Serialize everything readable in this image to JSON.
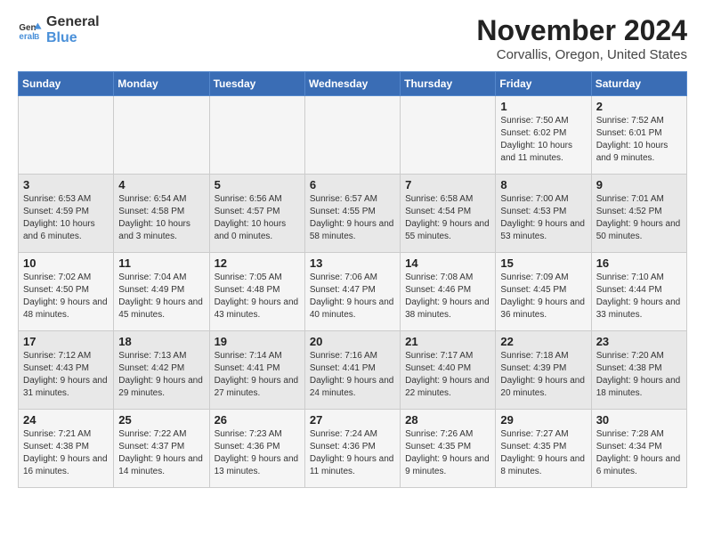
{
  "header": {
    "logo_line1": "General",
    "logo_line2": "Blue",
    "month_title": "November 2024",
    "location": "Corvallis, Oregon, United States"
  },
  "weekdays": [
    "Sunday",
    "Monday",
    "Tuesday",
    "Wednesday",
    "Thursday",
    "Friday",
    "Saturday"
  ],
  "weeks": [
    [
      {
        "day": "",
        "info": ""
      },
      {
        "day": "",
        "info": ""
      },
      {
        "day": "",
        "info": ""
      },
      {
        "day": "",
        "info": ""
      },
      {
        "day": "",
        "info": ""
      },
      {
        "day": "1",
        "info": "Sunrise: 7:50 AM\nSunset: 6:02 PM\nDaylight: 10 hours and 11 minutes."
      },
      {
        "day": "2",
        "info": "Sunrise: 7:52 AM\nSunset: 6:01 PM\nDaylight: 10 hours and 9 minutes."
      }
    ],
    [
      {
        "day": "3",
        "info": "Sunrise: 6:53 AM\nSunset: 4:59 PM\nDaylight: 10 hours and 6 minutes."
      },
      {
        "day": "4",
        "info": "Sunrise: 6:54 AM\nSunset: 4:58 PM\nDaylight: 10 hours and 3 minutes."
      },
      {
        "day": "5",
        "info": "Sunrise: 6:56 AM\nSunset: 4:57 PM\nDaylight: 10 hours and 0 minutes."
      },
      {
        "day": "6",
        "info": "Sunrise: 6:57 AM\nSunset: 4:55 PM\nDaylight: 9 hours and 58 minutes."
      },
      {
        "day": "7",
        "info": "Sunrise: 6:58 AM\nSunset: 4:54 PM\nDaylight: 9 hours and 55 minutes."
      },
      {
        "day": "8",
        "info": "Sunrise: 7:00 AM\nSunset: 4:53 PM\nDaylight: 9 hours and 53 minutes."
      },
      {
        "day": "9",
        "info": "Sunrise: 7:01 AM\nSunset: 4:52 PM\nDaylight: 9 hours and 50 minutes."
      }
    ],
    [
      {
        "day": "10",
        "info": "Sunrise: 7:02 AM\nSunset: 4:50 PM\nDaylight: 9 hours and 48 minutes."
      },
      {
        "day": "11",
        "info": "Sunrise: 7:04 AM\nSunset: 4:49 PM\nDaylight: 9 hours and 45 minutes."
      },
      {
        "day": "12",
        "info": "Sunrise: 7:05 AM\nSunset: 4:48 PM\nDaylight: 9 hours and 43 minutes."
      },
      {
        "day": "13",
        "info": "Sunrise: 7:06 AM\nSunset: 4:47 PM\nDaylight: 9 hours and 40 minutes."
      },
      {
        "day": "14",
        "info": "Sunrise: 7:08 AM\nSunset: 4:46 PM\nDaylight: 9 hours and 38 minutes."
      },
      {
        "day": "15",
        "info": "Sunrise: 7:09 AM\nSunset: 4:45 PM\nDaylight: 9 hours and 36 minutes."
      },
      {
        "day": "16",
        "info": "Sunrise: 7:10 AM\nSunset: 4:44 PM\nDaylight: 9 hours and 33 minutes."
      }
    ],
    [
      {
        "day": "17",
        "info": "Sunrise: 7:12 AM\nSunset: 4:43 PM\nDaylight: 9 hours and 31 minutes."
      },
      {
        "day": "18",
        "info": "Sunrise: 7:13 AM\nSunset: 4:42 PM\nDaylight: 9 hours and 29 minutes."
      },
      {
        "day": "19",
        "info": "Sunrise: 7:14 AM\nSunset: 4:41 PM\nDaylight: 9 hours and 27 minutes."
      },
      {
        "day": "20",
        "info": "Sunrise: 7:16 AM\nSunset: 4:41 PM\nDaylight: 9 hours and 24 minutes."
      },
      {
        "day": "21",
        "info": "Sunrise: 7:17 AM\nSunset: 4:40 PM\nDaylight: 9 hours and 22 minutes."
      },
      {
        "day": "22",
        "info": "Sunrise: 7:18 AM\nSunset: 4:39 PM\nDaylight: 9 hours and 20 minutes."
      },
      {
        "day": "23",
        "info": "Sunrise: 7:20 AM\nSunset: 4:38 PM\nDaylight: 9 hours and 18 minutes."
      }
    ],
    [
      {
        "day": "24",
        "info": "Sunrise: 7:21 AM\nSunset: 4:38 PM\nDaylight: 9 hours and 16 minutes."
      },
      {
        "day": "25",
        "info": "Sunrise: 7:22 AM\nSunset: 4:37 PM\nDaylight: 9 hours and 14 minutes."
      },
      {
        "day": "26",
        "info": "Sunrise: 7:23 AM\nSunset: 4:36 PM\nDaylight: 9 hours and 13 minutes."
      },
      {
        "day": "27",
        "info": "Sunrise: 7:24 AM\nSunset: 4:36 PM\nDaylight: 9 hours and 11 minutes."
      },
      {
        "day": "28",
        "info": "Sunrise: 7:26 AM\nSunset: 4:35 PM\nDaylight: 9 hours and 9 minutes."
      },
      {
        "day": "29",
        "info": "Sunrise: 7:27 AM\nSunset: 4:35 PM\nDaylight: 9 hours and 8 minutes."
      },
      {
        "day": "30",
        "info": "Sunrise: 7:28 AM\nSunset: 4:34 PM\nDaylight: 9 hours and 6 minutes."
      }
    ]
  ]
}
